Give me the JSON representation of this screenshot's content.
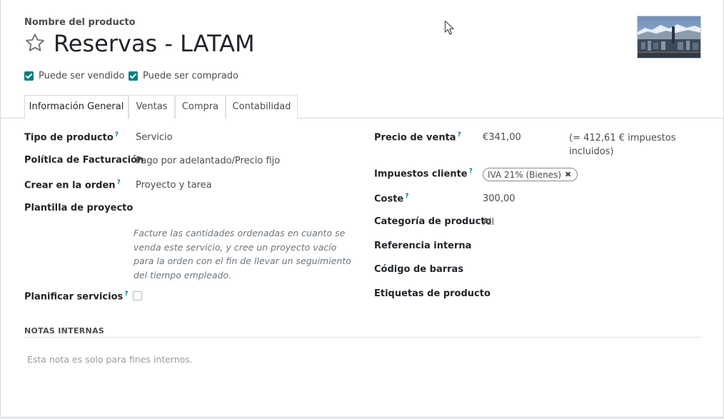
{
  "header": {
    "name_label": "Nombre del producto",
    "title": "Reservas - LATAM",
    "star_icon": "star-outline-icon",
    "image_alt": "product-image"
  },
  "checks": {
    "can_be_sold": {
      "label": "Puede ser vendido",
      "checked": true
    },
    "can_be_purchased": {
      "label": "Puede ser comprado",
      "checked": true
    }
  },
  "tabs": [
    {
      "label": "Información General",
      "active": true
    },
    {
      "label": "Ventas",
      "active": false
    },
    {
      "label": "Compra",
      "active": false
    },
    {
      "label": "Contabilidad",
      "active": false
    }
  ],
  "left_fields": {
    "product_type": {
      "label": "Tipo de producto",
      "help": "?",
      "value": "Servicio"
    },
    "invoicing_policy": {
      "label": "Política de Facturación",
      "value": "Pago por adelantado/Precio fijo"
    },
    "create_on_order": {
      "label": "Crear en la orden",
      "help": "?",
      "value": "Proyecto y tarea"
    },
    "project_template": {
      "label": "Plantilla de proyecto",
      "value": ""
    },
    "help_text": "Facture las cantidades ordenadas en cuanto se venda este servicio, y cree un proyecto vacío para la orden con el fin de llevar un seguimiento del tiempo empleado.",
    "plan_services": {
      "label": "Planificar servicios",
      "help": "?",
      "checked": false
    }
  },
  "right_fields": {
    "sales_price": {
      "label": "Precio de venta",
      "help": "?",
      "value": "€341,00",
      "tax_included": "(= 412,61 € impuestos incluidos)"
    },
    "customer_taxes": {
      "label": "Impuestos cliente",
      "help": "?",
      "tag": "IVA 21% (Bienes)",
      "remove_icon": "close-icon"
    },
    "cost": {
      "label": "Coste",
      "help": "?",
      "value": "300,00"
    },
    "category": {
      "label": "Categoría de producto",
      "value": "All"
    },
    "internal_ref": {
      "label": "Referencia interna",
      "value": ""
    },
    "barcode": {
      "label": "Código de barras",
      "value": ""
    },
    "tags": {
      "label": "Etiquetas de producto",
      "value": ""
    }
  },
  "notes": {
    "title": "NOTAS INTERNAS",
    "placeholder": "Esta nota es solo para fines internos."
  },
  "colors": {
    "accent": "#017e84",
    "text": "#4c4c4c",
    "heading": "#212529"
  }
}
